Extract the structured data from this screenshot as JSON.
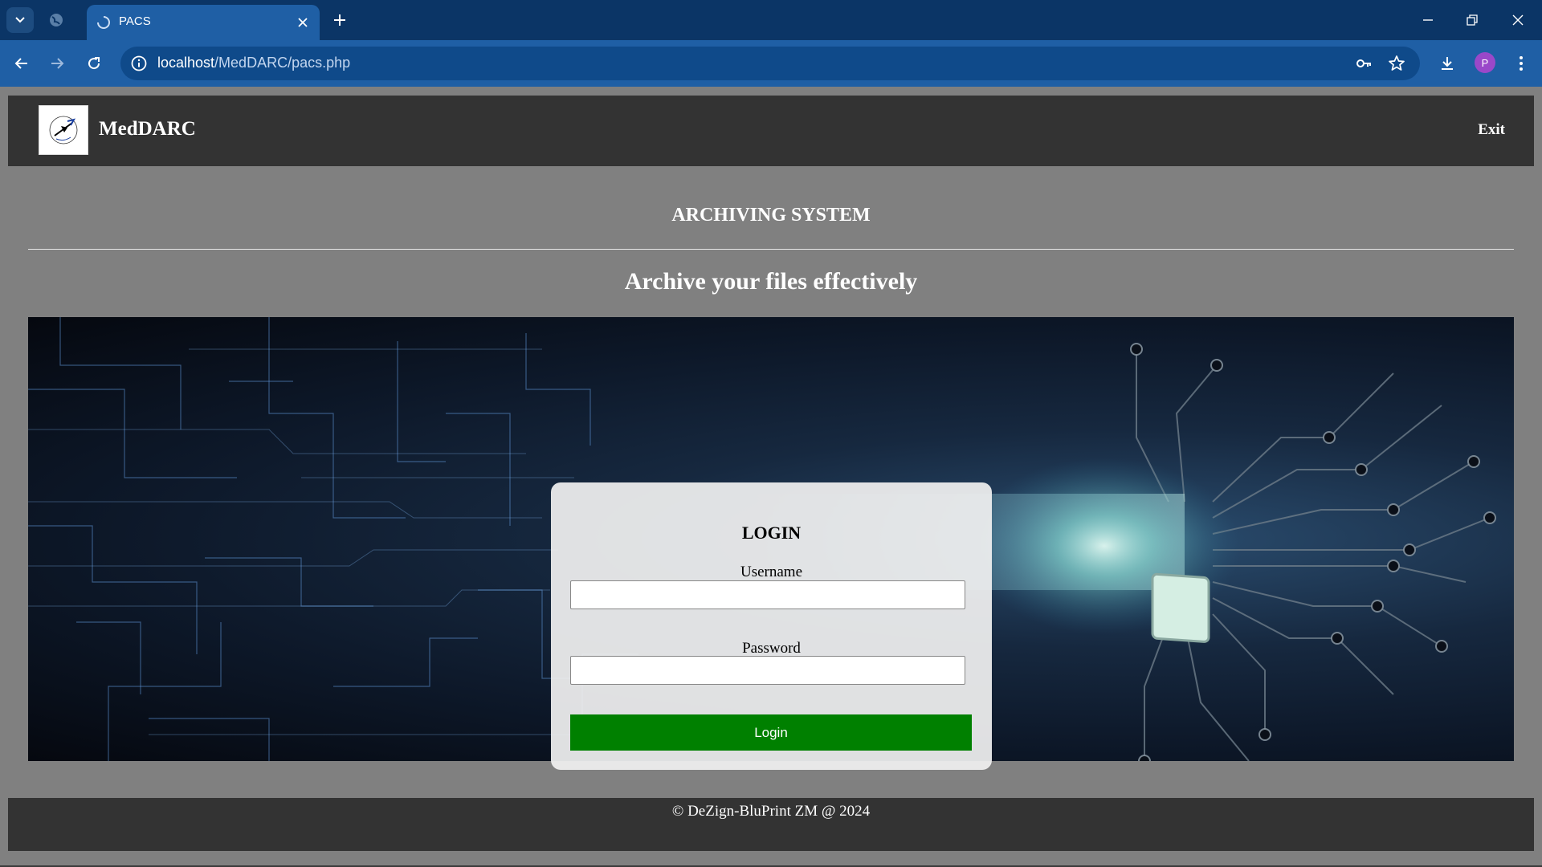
{
  "browser": {
    "tab_title": "PACS",
    "url_host": "localhost",
    "url_path": "/MedDARC/pacs.php",
    "profile_initial": "P",
    "accent_color": "#1f5fa5",
    "icons": [
      "tab-list-icon",
      "globe-icon",
      "loading-icon",
      "close-icon",
      "plus-icon",
      "minimize-icon",
      "restore-icon",
      "back-icon",
      "forward-icon",
      "reload-icon",
      "info-icon",
      "key-icon",
      "star-icon",
      "download-icon",
      "menu-icon"
    ]
  },
  "header": {
    "brand": "MedDARC",
    "exit_label": "Exit",
    "background": "#333333"
  },
  "page": {
    "system_title": "ARCHIVING SYSTEM",
    "tagline": "Archive your files effectively",
    "background": "#808080"
  },
  "login": {
    "title": "LOGIN",
    "username_label": "Username",
    "username_value": "",
    "password_label": "Password",
    "password_value": "",
    "button_label": "Login",
    "button_color": "#008000"
  },
  "footer": {
    "copyright": "© DeZign-BluPrint ZM @ 2024"
  }
}
